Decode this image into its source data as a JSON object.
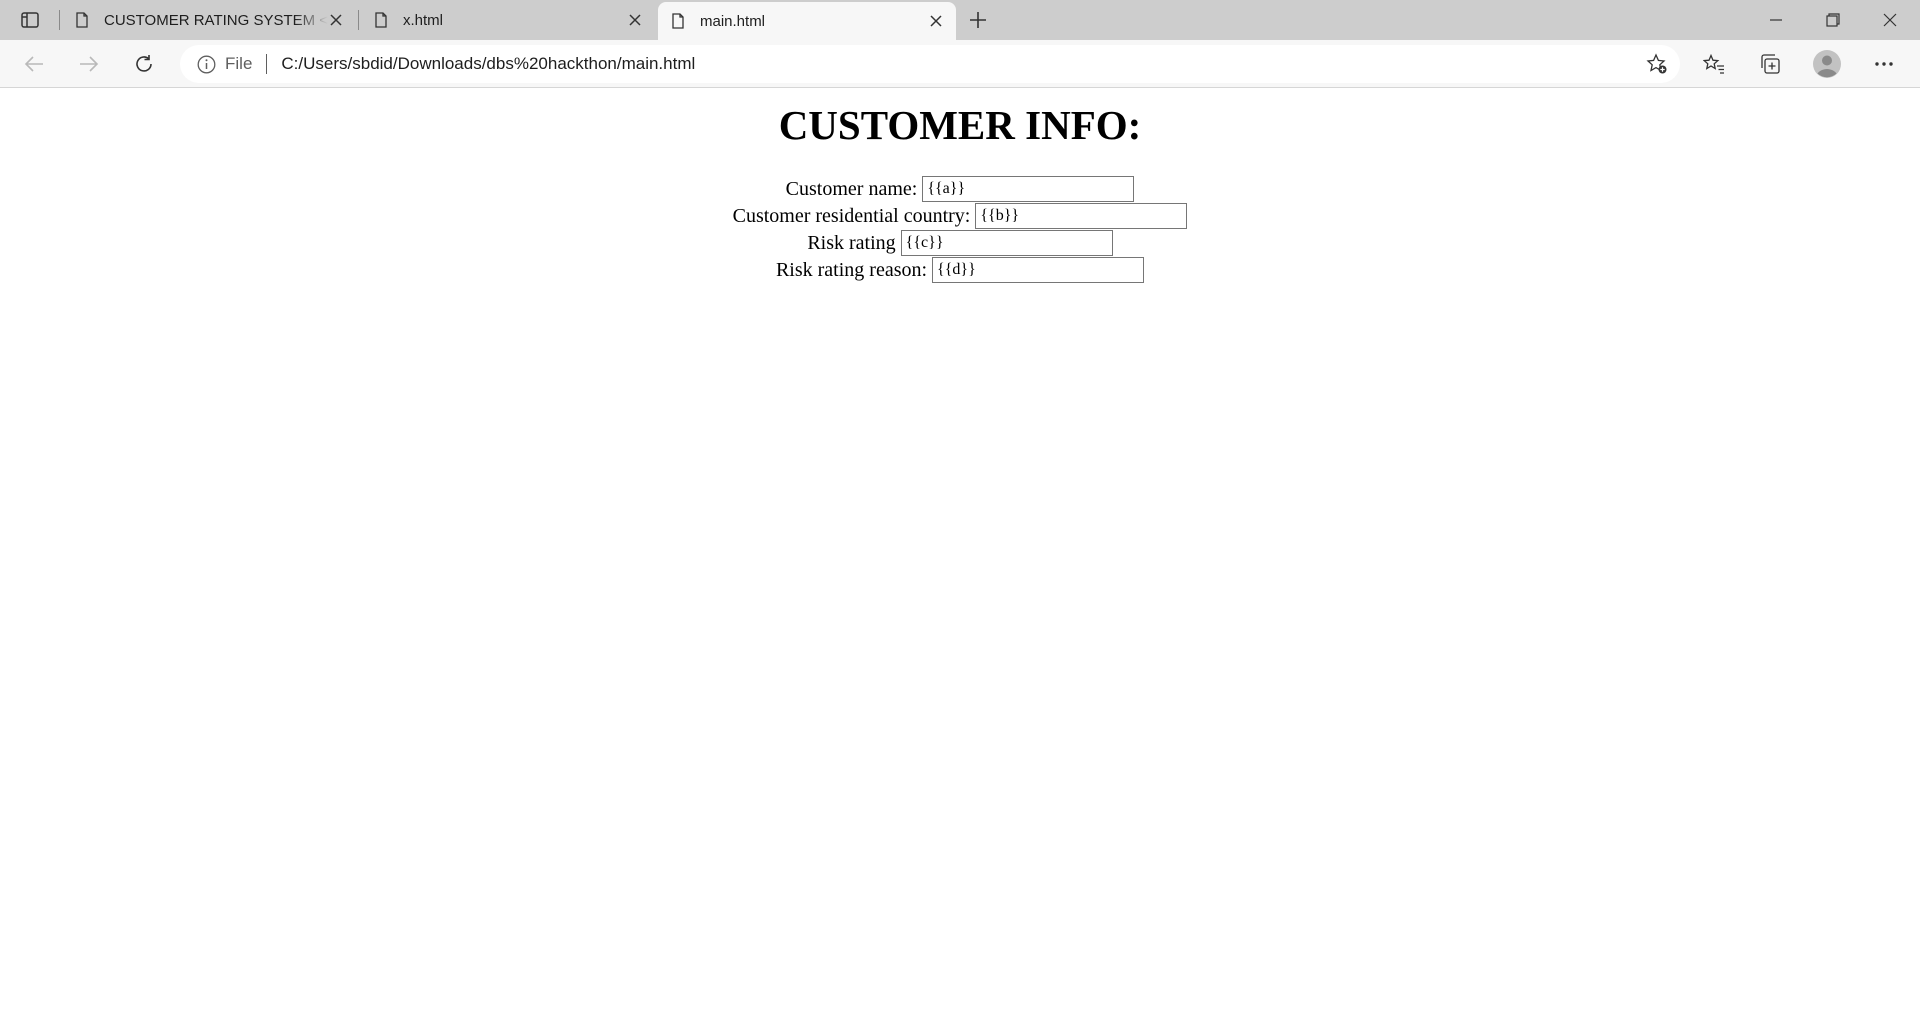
{
  "tabs": [
    {
      "label": "CUSTOMER RATING SYSTEM <sc",
      "active": false
    },
    {
      "label": "x.html",
      "active": false
    },
    {
      "label": "main.html",
      "active": true
    }
  ],
  "address": {
    "scheme_label": "File",
    "url": "C:/Users/sbdid/Downloads/dbs%20hackthon/main.html"
  },
  "page": {
    "heading": "CUSTOMER INFO:",
    "fields": [
      {
        "label": "Customer name:",
        "value": "{{a}}"
      },
      {
        "label": "Customer residential country:",
        "value": "{{b}}"
      },
      {
        "label": "Risk rating",
        "value": "{{c}}"
      },
      {
        "label": "Risk rating reason:",
        "value": "{{d}}"
      }
    ]
  },
  "icons": {
    "tab_actions": "tab-actions-icon",
    "page": "page-icon",
    "close": "close-icon",
    "new_tab": "plus-icon",
    "back": "back-arrow-icon",
    "forward": "forward-arrow-icon",
    "refresh": "refresh-icon",
    "info": "info-icon",
    "add_favorite": "star-add-icon",
    "favorites": "favorites-icon",
    "collections": "collections-icon",
    "profile": "profile-icon",
    "menu": "more-icon"
  }
}
